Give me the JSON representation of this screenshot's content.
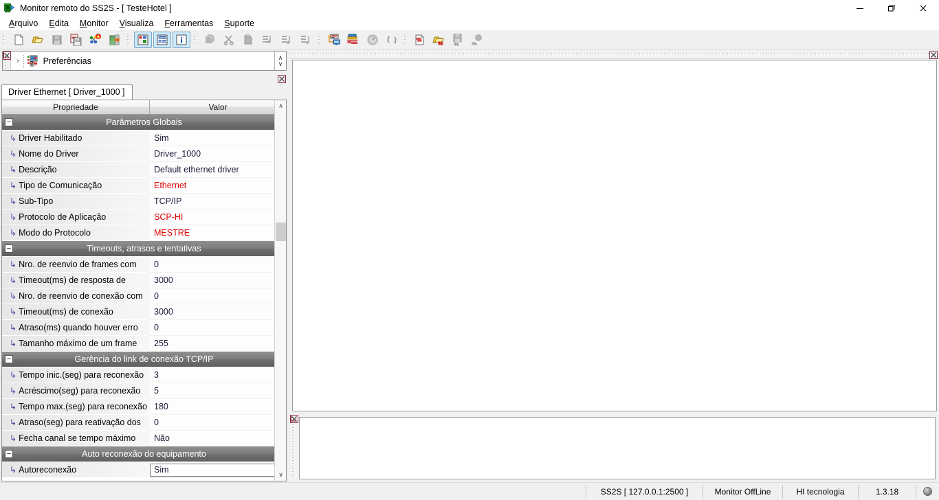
{
  "window": {
    "title": "Monitor remoto do SS2S - [ TesteHotel ]",
    "icon": "monitor-play-icon",
    "minimize_label": "—",
    "maximize_label": "❐",
    "close_label": "✕"
  },
  "menubar": {
    "items": [
      {
        "name": "arquivo",
        "accel": "A",
        "rest": "rquivo"
      },
      {
        "name": "edita",
        "accel": "E",
        "rest": "dita"
      },
      {
        "name": "monitor",
        "accel": "M",
        "rest": "onitor"
      },
      {
        "name": "visualiza",
        "accel": "V",
        "rest": "isualiza"
      },
      {
        "name": "ferramentas",
        "accel": "F",
        "rest": "erramentas"
      },
      {
        "name": "suporte",
        "accel": "S",
        "rest": "uporte"
      }
    ]
  },
  "toolbar": {
    "groups": [
      {
        "name": "file-group",
        "buttons": [
          {
            "name": "new-document-button",
            "icon": "new-document-icon",
            "enabled": true,
            "checked": false
          },
          {
            "name": "open-folder-button",
            "icon": "open-folder-icon",
            "enabled": true,
            "checked": false
          },
          {
            "name": "save-button",
            "icon": "save-disk-icon",
            "enabled": false,
            "checked": false
          },
          {
            "name": "save-all-button",
            "icon": "save-all-icon",
            "enabled": true,
            "checked": false
          },
          {
            "name": "compile-button",
            "icon": "network-star-icon",
            "enabled": true,
            "checked": false
          },
          {
            "name": "exit-button",
            "icon": "exit-door-icon",
            "enabled": true,
            "checked": false
          }
        ]
      },
      {
        "name": "view-group",
        "buttons": [
          {
            "name": "view-tree-button",
            "icon": "tree-view-icon",
            "enabled": true,
            "checked": true
          },
          {
            "name": "view-grid-button",
            "icon": "grid-view-icon",
            "enabled": true,
            "checked": true
          },
          {
            "name": "view-info-button",
            "icon": "info-panel-icon",
            "enabled": true,
            "checked": true
          }
        ]
      },
      {
        "name": "edit-group",
        "buttons": [
          {
            "name": "copy-button",
            "icon": "copy-icon",
            "enabled": false,
            "checked": false
          },
          {
            "name": "cut-button",
            "icon": "scissors-icon",
            "enabled": false,
            "checked": false
          },
          {
            "name": "paste-button",
            "icon": "paste-icon",
            "enabled": false,
            "checked": false
          },
          {
            "name": "insert-row-button",
            "icon": "insert-row-icon",
            "enabled": false,
            "checked": false
          },
          {
            "name": "append-row-button",
            "icon": "append-row-icon",
            "enabled": false,
            "checked": false
          },
          {
            "name": "delete-row-button",
            "icon": "delete-row-icon",
            "enabled": false,
            "checked": false
          }
        ]
      },
      {
        "name": "monitor-group",
        "buttons": [
          {
            "name": "connect-device-button",
            "icon": "device-connect-icon",
            "enabled": true,
            "checked": false
          },
          {
            "name": "checklist-button",
            "icon": "checklist-icon",
            "enabled": true,
            "checked": false
          },
          {
            "name": "gauge-button",
            "icon": "gauge-icon",
            "enabled": false,
            "checked": false
          },
          {
            "name": "refresh-button",
            "icon": "refresh-icon",
            "enabled": false,
            "checked": false
          }
        ]
      },
      {
        "name": "trace-group",
        "buttons": [
          {
            "name": "new-trace-button",
            "icon": "trace-document-icon",
            "enabled": true,
            "checked": false
          },
          {
            "name": "open-trace-button",
            "icon": "trace-folder-icon",
            "enabled": true,
            "checked": false
          },
          {
            "name": "save-trace-button",
            "icon": "trace-save-icon",
            "enabled": false,
            "checked": false
          },
          {
            "name": "stop-trace-button",
            "icon": "trace-stop-icon",
            "enabled": false,
            "checked": false
          }
        ]
      }
    ]
  },
  "tree_panel": {
    "close_icon": "panel-close-icon",
    "expand_arrow": "›",
    "node_icon": "preferences-icon",
    "label": "Preferências",
    "spinner_up": "∧",
    "spinner_down": "∨"
  },
  "left_dock": {
    "tab": {
      "name": "driver-ethernet-tab",
      "label": "Driver Ethernet [ Driver_1000 ]"
    },
    "close_icon": "dock-close-icon",
    "grid": {
      "headers": {
        "property": "Propriedade",
        "value": "Valor"
      },
      "expander_glyph": "−",
      "elbow_glyph": "↳",
      "scroll_up": "∧",
      "scroll_down": "∨",
      "rows": [
        {
          "type": "section",
          "label": "Parâmetros Globais"
        },
        {
          "type": "prop",
          "label": "Driver Habilitado",
          "value": "Sim",
          "style": "normal"
        },
        {
          "type": "prop",
          "label": "Nome do Driver",
          "value": "Driver_1000",
          "style": "normal"
        },
        {
          "type": "prop",
          "label": "Descrição",
          "value": "Default ethernet driver",
          "style": "normal"
        },
        {
          "type": "prop",
          "label": "Tipo de Comunicação",
          "value": "Ethernet",
          "style": "red"
        },
        {
          "type": "prop",
          "label": "Sub-Tipo",
          "value": "TCP/IP",
          "style": "normal"
        },
        {
          "type": "prop",
          "label": "Protocolo de Aplicação",
          "value": "SCP-HI",
          "style": "red"
        },
        {
          "type": "prop",
          "label": "Modo do Protocolo",
          "value": "MESTRE",
          "style": "red"
        },
        {
          "type": "section",
          "label": "Timeouts, atrasos e tentativas"
        },
        {
          "type": "prop",
          "label": "Nro. de reenvio de frames com",
          "value": "0",
          "style": "normal"
        },
        {
          "type": "prop",
          "label": "Timeout(ms) de resposta de",
          "value": "3000",
          "style": "normal"
        },
        {
          "type": "prop",
          "label": "Nro. de reenvio de conexão com",
          "value": "0",
          "style": "normal"
        },
        {
          "type": "prop",
          "label": "Timeout(ms) de conexão",
          "value": "3000",
          "style": "normal"
        },
        {
          "type": "prop",
          "label": "Atraso(ms) quando houver erro",
          "value": "0",
          "style": "normal"
        },
        {
          "type": "prop",
          "label": "Tamanho máximo de um frame",
          "value": "255",
          "style": "normal"
        },
        {
          "type": "section",
          "label": "Gerência do link de conexão TCP/IP"
        },
        {
          "type": "prop",
          "label": "Tempo inic.(seg) para reconexão",
          "value": "3",
          "style": "normal"
        },
        {
          "type": "prop",
          "label": "Acréscimo(seg) para reconexão",
          "value": "5",
          "style": "normal"
        },
        {
          "type": "prop",
          "label": "Tempo max.(seg) para reconexão",
          "value": "180",
          "style": "normal"
        },
        {
          "type": "prop",
          "label": "Atraso(seg) para reativação dos",
          "value": "0",
          "style": "normal"
        },
        {
          "type": "prop",
          "label": "Fecha canal se tempo máximo",
          "value": "Não",
          "style": "normal"
        },
        {
          "type": "section",
          "label": "Auto reconexão do equipamento"
        },
        {
          "type": "combo",
          "label": "Autoreconexão",
          "value": "Sim",
          "style": "normal"
        }
      ]
    }
  },
  "main_area": {
    "close_icon": "main-panel-close-icon",
    "canvas_content": ""
  },
  "bottom_dock": {
    "close_icon": "bottom-panel-close-icon",
    "canvas_content": ""
  },
  "statusbar": {
    "cells": [
      {
        "name": "connection-info",
        "text": "SS2S [ 127.0.0.1:2500 ]"
      },
      {
        "name": "monitor-state",
        "text": "Monitor OffLine"
      },
      {
        "name": "company-name",
        "text": "HI tecnologia"
      },
      {
        "name": "version",
        "text": "1.3.18"
      }
    ],
    "globe_icon": "globe-icon"
  },
  "colors": {
    "accent_red": "#e00000",
    "section_bar": "#707070",
    "toolbar_checked": "#cde9fb",
    "window_bg": "#f0f0f0"
  }
}
